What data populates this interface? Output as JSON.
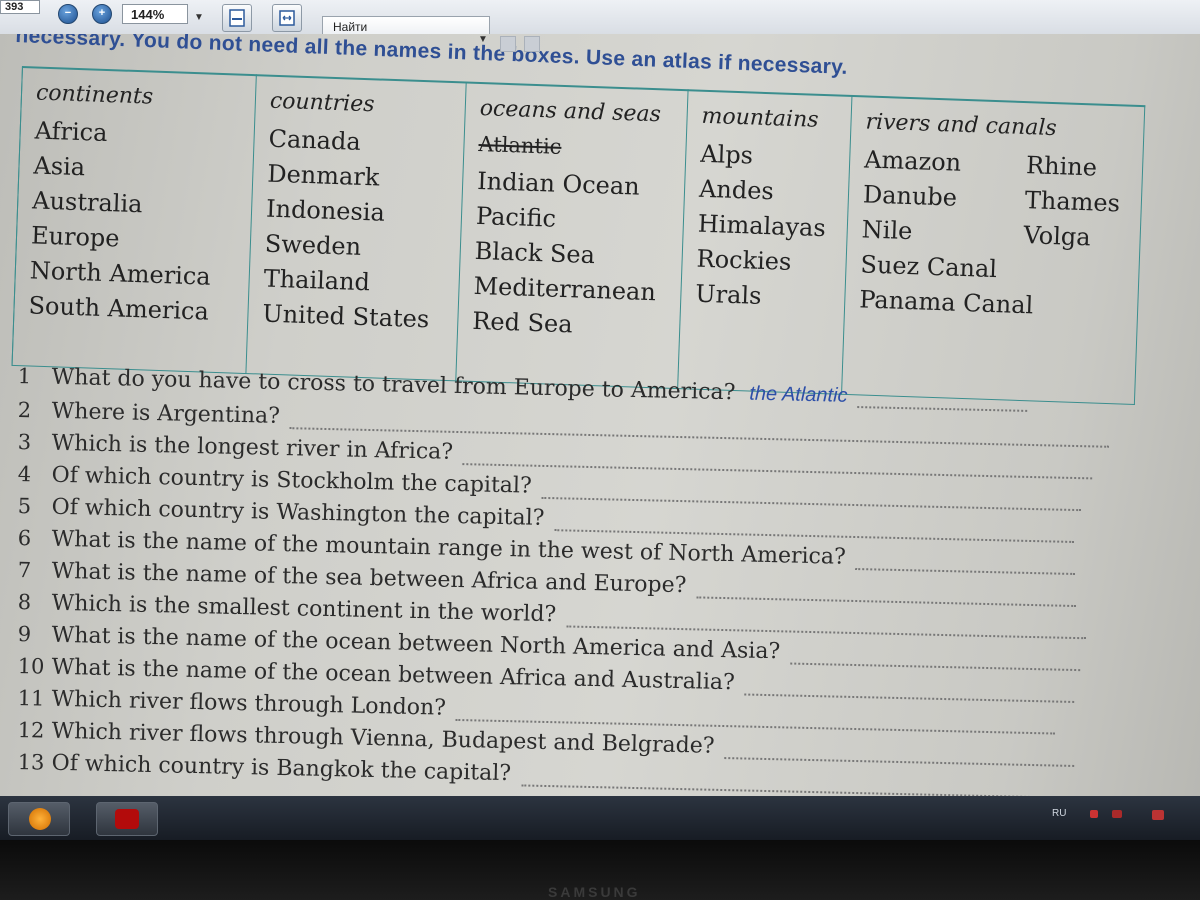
{
  "toolbar": {
    "page_number": "393",
    "zoom": "144%",
    "search_label": "Найти"
  },
  "document": {
    "instruction": "necessary. You do not need all the names in the boxes. Use an atlas if necessary.",
    "table": {
      "continents": {
        "heading": "continents",
        "items": [
          "Africa",
          "Asia",
          "Australia",
          "Europe",
          "North America",
          "South America"
        ]
      },
      "countries": {
        "heading": "countries",
        "items": [
          "Canada",
          "Denmark",
          "Indonesia",
          "Sweden",
          "Thailand",
          "United States"
        ]
      },
      "oceans": {
        "heading": "oceans and seas",
        "items": [
          "Atlantic",
          "Indian Ocean",
          "Pacific",
          "Black Sea",
          "Mediterranean",
          "Red Sea"
        ]
      },
      "mountains": {
        "heading": "mountains",
        "items": [
          "Alps",
          "Andes",
          "Himalayas",
          "Rockies",
          "Urals"
        ]
      },
      "rivers": {
        "heading": "rivers and canals",
        "items_left": [
          "Amazon",
          "Danube",
          "Nile",
          "Suez Canal",
          "Panama Canal"
        ],
        "items_right": [
          "Rhine",
          "Thames",
          "Volga"
        ]
      }
    },
    "questions": [
      {
        "num": "1",
        "text": "What do you have to cross to travel from Europe to America?",
        "answer": "the Atlantic"
      },
      {
        "num": "2",
        "text": "Where is Argentina?",
        "answer": ""
      },
      {
        "num": "3",
        "text": "Which is the longest river in Africa?",
        "answer": ""
      },
      {
        "num": "4",
        "text": "Of which country is Stockholm the capital?",
        "answer": ""
      },
      {
        "num": "5",
        "text": "Of which country is Washington the capital?",
        "answer": ""
      },
      {
        "num": "6",
        "text": "What is the name of the mountain range in the west of North America?",
        "answer": ""
      },
      {
        "num": "7",
        "text": "What is the name of the sea between Africa and Europe?",
        "answer": ""
      },
      {
        "num": "8",
        "text": "Which is the smallest continent in the world?",
        "answer": ""
      },
      {
        "num": "9",
        "text": "What is the name of the ocean between North America and Asia?",
        "answer": ""
      },
      {
        "num": "10",
        "text": "What is the name of the ocean between Africa and Australia?",
        "answer": ""
      },
      {
        "num": "11",
        "text": "Which river flows through London?",
        "answer": ""
      },
      {
        "num": "12",
        "text": "Which river flows through Vienna, Budapest and Belgrade?",
        "answer": ""
      },
      {
        "num": "13",
        "text": "Of which country is Bangkok the capital?",
        "answer": ""
      }
    ]
  },
  "taskbar": {
    "language": "RU",
    "apps": [
      "media-player-icon",
      "pdf-reader-icon"
    ],
    "accent_colors": {
      "table_border": "#3b8e8e",
      "instruction_blue": "#2f4f94",
      "answer_blue": "#2d4fa8"
    }
  },
  "monitor": {
    "brand": "SAMSUNG"
  }
}
